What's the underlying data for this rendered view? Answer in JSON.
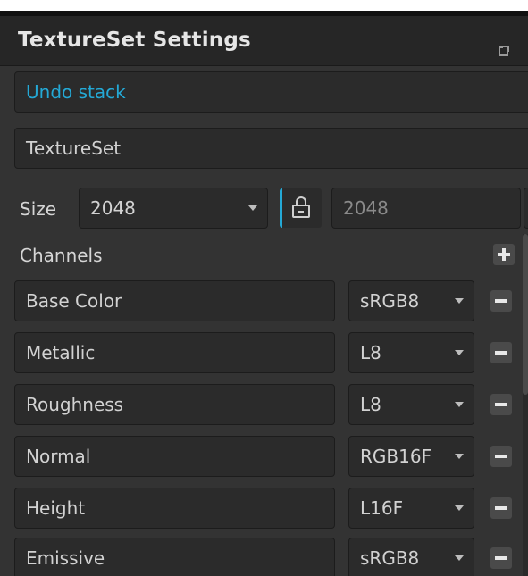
{
  "panel": {
    "title": "TextureSet Settings",
    "popout_icon": "popout-icon"
  },
  "undo_stack": {
    "label": "Undo stack",
    "color": "#24a9d6"
  },
  "textureset": {
    "name": "TextureSet"
  },
  "size": {
    "label": "Size",
    "width_value": "2048",
    "height_value": "2048",
    "lock_icon": "lock-icon",
    "lock_accent": "#24a9d6"
  },
  "channels": {
    "label": "Channels",
    "add_icon": "plus-icon",
    "remove_icon": "minus-icon",
    "items": [
      {
        "name": "Base Color",
        "format": "sRGB8"
      },
      {
        "name": "Metallic",
        "format": "L8"
      },
      {
        "name": "Roughness",
        "format": "L8"
      },
      {
        "name": "Normal",
        "format": "RGB16F"
      },
      {
        "name": "Height",
        "format": "L16F"
      },
      {
        "name": "Emissive",
        "format": "sRGB8"
      }
    ]
  }
}
